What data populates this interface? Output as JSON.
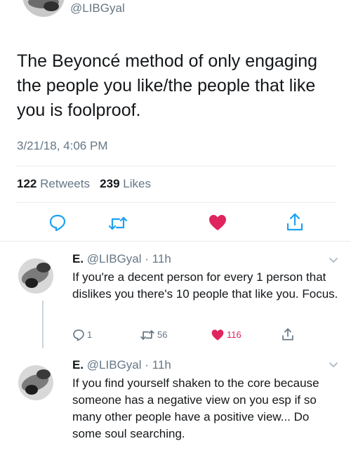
{
  "top_tweet": {
    "handle": "@LIBGyal",
    "text": "The Beyoncé method of only engaging the people you like/the people that like you is foolproof.",
    "date": "3/21/18, 4:06 PM",
    "retweets_count": "122",
    "retweets_label": "Retweets",
    "likes_count": "239",
    "likes_label": "Likes"
  },
  "replies": [
    {
      "name": "E.",
      "handle": "@LIBGyal",
      "separator": "·",
      "time": "11h",
      "text": "If you're a decent person for every 1 person that dislikes you there's 10 people that like you. Focus.",
      "reply_count": "1",
      "retweet_count": "56",
      "like_count": "116"
    },
    {
      "name": "E.",
      "handle": "@LIBGyal",
      "separator": "·",
      "time": "11h",
      "text": "If you find yourself shaken to the core because someone has a negative view on you esp if so many other people have a positive view... Do some soul searching."
    }
  ],
  "colors": {
    "text_primary": "#14171a",
    "text_secondary": "#657786",
    "accent_blue": "#1da1f2",
    "like_red": "#e0245e",
    "divider": "#e6ecf0"
  }
}
